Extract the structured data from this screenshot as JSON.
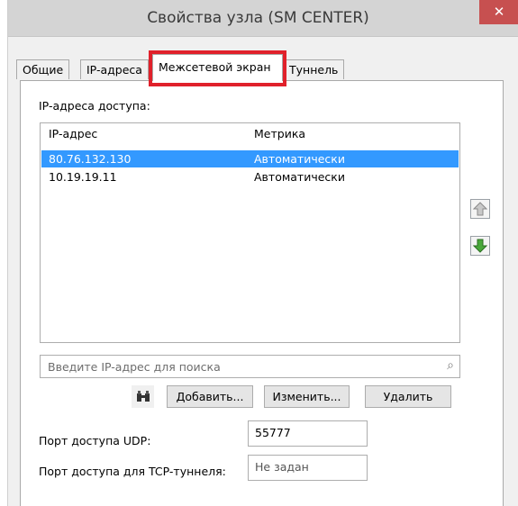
{
  "window": {
    "title": "Свойства узла (SM CENTER)",
    "close_symbol": "✕"
  },
  "tabs": [
    {
      "label": "Общие",
      "active": false
    },
    {
      "label": "IP-адреса",
      "active": false
    },
    {
      "label": "Межсетевой экран",
      "active": true
    },
    {
      "label": "Туннель",
      "active": false
    }
  ],
  "access_section": {
    "label": "IP-адреса доступа:"
  },
  "list": {
    "columns": [
      "IP-адрес",
      "Метрика"
    ],
    "rows": [
      {
        "ip": "80.76.132.130",
        "metric": "Автоматически",
        "selected": true
      },
      {
        "ip": "10.19.19.11",
        "metric": "Автоматически",
        "selected": false
      }
    ]
  },
  "search": {
    "placeholder": "Введите IP-адрес для поиска"
  },
  "buttons": {
    "add": "Добавить...",
    "edit": "Изменить...",
    "delete": "Удалить"
  },
  "udp": {
    "label": "Порт доступа UDP:",
    "value": "55777"
  },
  "tcp": {
    "label": "Порт доступа для TCP-туннеля:",
    "value": "Не задан"
  },
  "colors": {
    "selection": "#3399ff",
    "close": "#c75050",
    "highlight": "#e0212b"
  },
  "icons": [
    "close-icon",
    "move-up-icon",
    "move-down-icon",
    "binoculars-icon",
    "search-icon"
  ]
}
